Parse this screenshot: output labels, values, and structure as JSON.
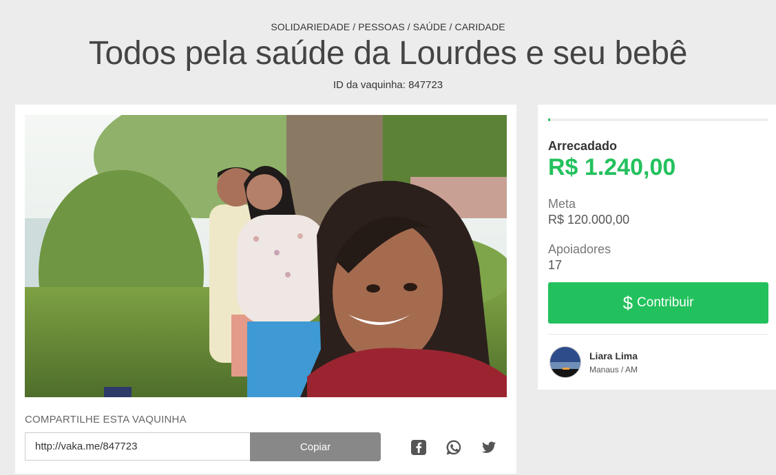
{
  "header": {
    "breadcrumb": "SOLIDARIEDADE / PESSOAS / SAÚDE / CARIDADE",
    "title": "Todos pela saúde da Lourdes e seu bebê",
    "campaign_id": "ID da vaquinha: 847723"
  },
  "main": {
    "photo_icon": "family-selfie-photo",
    "share": {
      "label": "COMPARTILHE ESTA VAQUINHA",
      "url_value": "http://vaka.me/847723",
      "copy_label": "Copiar",
      "icons": [
        "facebook-icon",
        "whatsapp-icon",
        "twitter-icon"
      ]
    }
  },
  "sidebar": {
    "progress_fraction": 0.0103,
    "raised_label": "Arrecadado",
    "raised_value": "R$ 1.240,00",
    "goal_label": "Meta",
    "goal_value": "R$ 120.000,00",
    "supporters_label": "Apoiadores",
    "supporters_value": "17",
    "contribute_icon": "$",
    "contribute_label": "Contribuir",
    "owner": {
      "name": "Liara Lima",
      "location": "Manaus / AM"
    }
  },
  "colors": {
    "accent_green": "#23c15d",
    "background": "#ececec",
    "copy_button": "#888888"
  }
}
